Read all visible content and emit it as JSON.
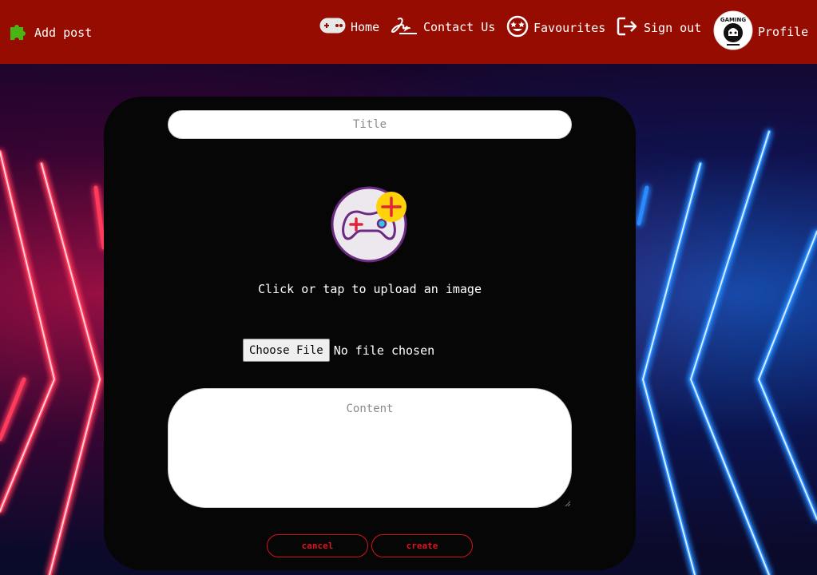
{
  "header": {
    "add_post": "Add post",
    "nav": [
      {
        "label": "Home",
        "icon": "gamepad-icon"
      },
      {
        "label": "Contact Us",
        "icon": "signature-icon"
      },
      {
        "label": "Favourites",
        "icon": "star-eyes-icon"
      },
      {
        "label": "Sign out",
        "icon": "sign-out-icon"
      }
    ],
    "profile": "Profile",
    "avatar_text": "GAMING"
  },
  "form": {
    "title_placeholder": "Title",
    "upload_text": "Click or tap to upload an image",
    "choose_file": "Choose File",
    "file_status": "No file chosen",
    "content_placeholder": "Content",
    "cancel_label": "cancel",
    "create_label": "create"
  },
  "colors": {
    "header_bg": "#970c00",
    "card_bg": "#060606",
    "button_accent": "#d0141c"
  }
}
